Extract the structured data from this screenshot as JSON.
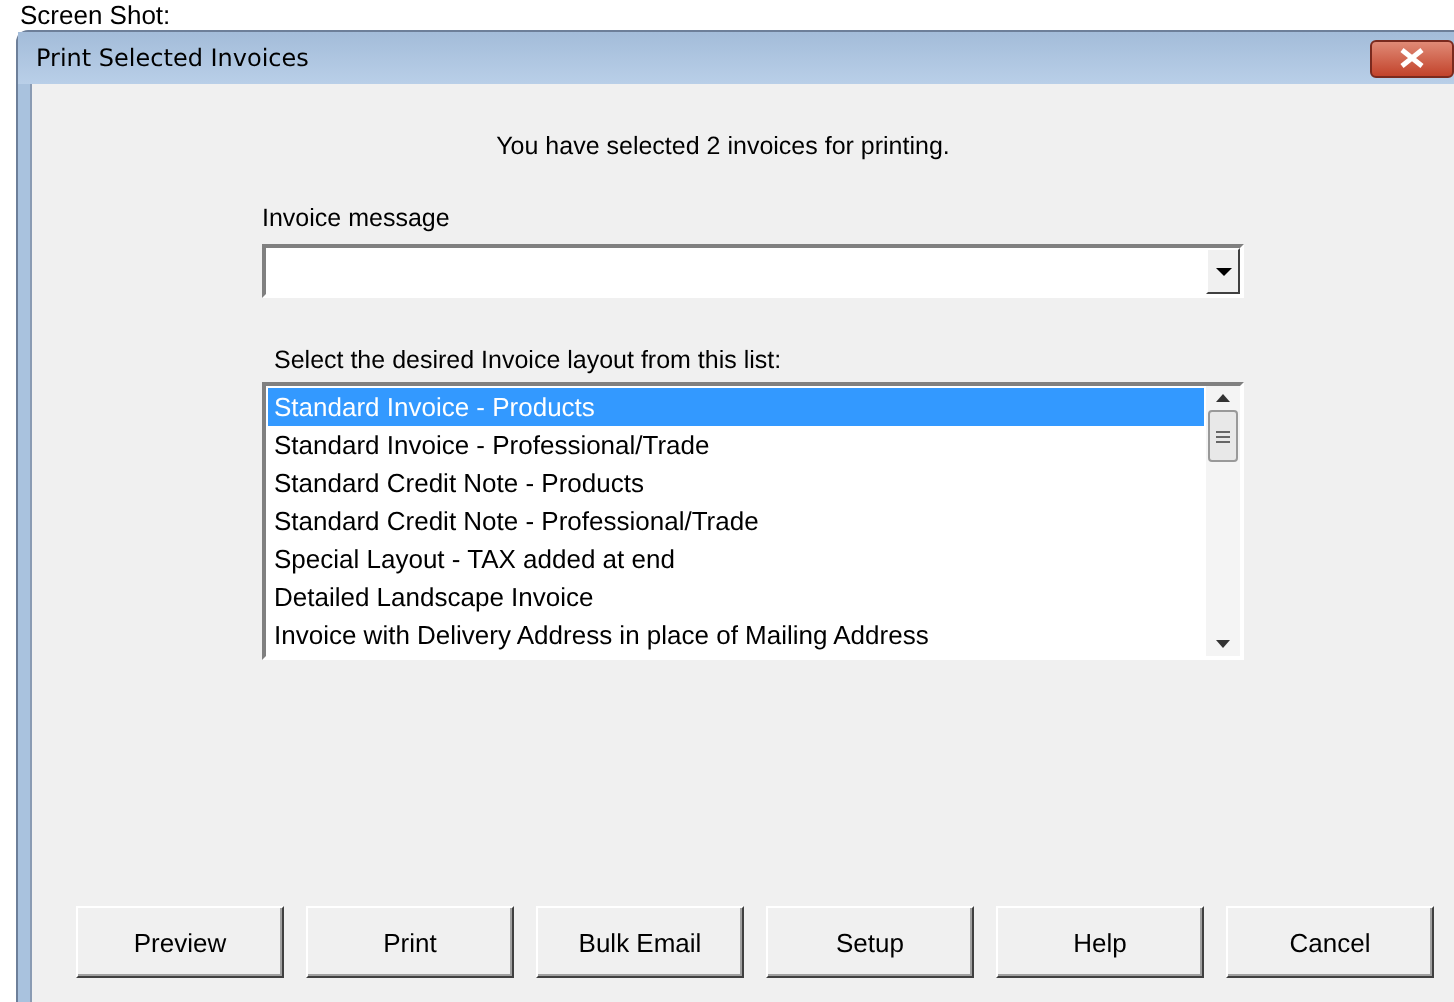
{
  "caption": "Screen Shot:",
  "window": {
    "title": "Print Selected Invoices"
  },
  "message": "You have selected 2 invoices for printing.",
  "invoice_message": {
    "label": "Invoice message"
  },
  "layout_list": {
    "label": "Select the desired Invoice layout from this list:",
    "items": [
      {
        "label": "Standard Invoice - Products",
        "selected": true
      },
      {
        "label": "Standard Invoice - Professional/Trade",
        "selected": false
      },
      {
        "label": "Standard Credit Note - Products",
        "selected": false
      },
      {
        "label": "Standard Credit Note - Professional/Trade",
        "selected": false
      },
      {
        "label": "Special Layout - TAX added at end",
        "selected": false
      },
      {
        "label": "Detailed Landscape Invoice",
        "selected": false
      },
      {
        "label": "Invoice with Delivery Address in place of Mailing Address",
        "selected": false
      }
    ]
  },
  "buttons": [
    "Preview",
    "Print",
    "Bulk Email",
    "Setup",
    "Help",
    "Cancel"
  ]
}
